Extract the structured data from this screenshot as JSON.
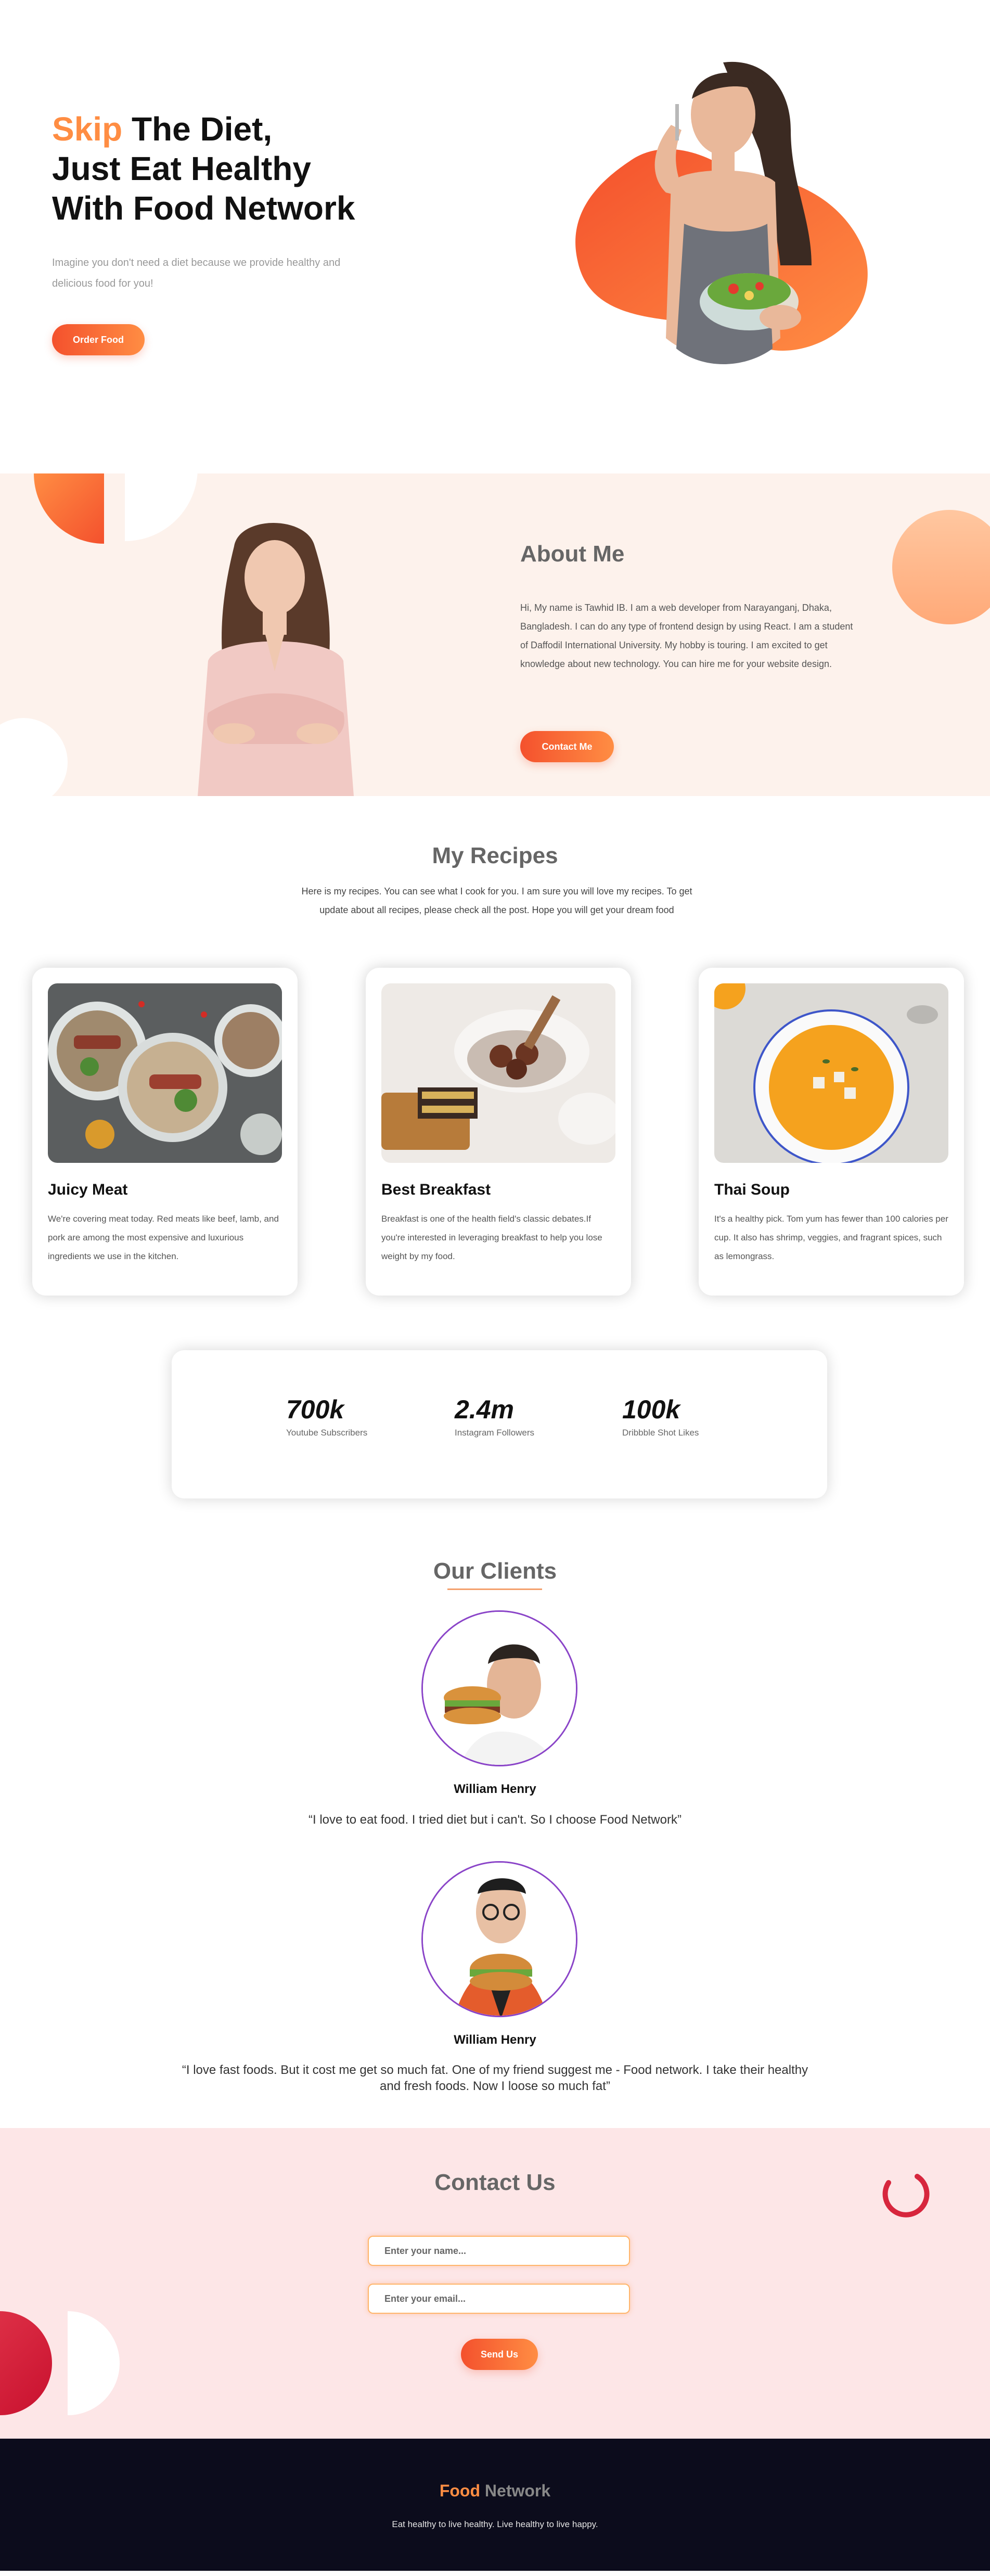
{
  "hero": {
    "title_accent": "Skip",
    "title_line1": " The Diet,",
    "title_line2": "Just Eat Healthy",
    "title_line3": "With Food Network",
    "subtitle": "Imagine you don't need a diet because we provide healthy and delicious food for you!",
    "button_label": "Order Food"
  },
  "about": {
    "title": "About Me",
    "text": "Hi, My name is Tawhid IB. I am a web developer from Narayanganj, Dhaka, Bangladesh. I can do any type of frontend design by using React. I am a student of Daffodil International University. My hobby is touring. I am excited to get knowledge about new technology. You can hire me for your website design.",
    "button_label": "Contact Me"
  },
  "recipes": {
    "title": "My Recipes",
    "intro": "Here is my recipes. You can see what I cook for you. I am sure you will love my recipes. To get update about all recipes, please check all the post. Hope you will get your dream food",
    "cards": [
      {
        "title": "Juicy Meat",
        "text": "We're covering meat today. Red meats like beef, lamb, and pork are among the most expensive and luxurious ingredients we use in the kitchen."
      },
      {
        "title": "Best Breakfast",
        "text": "Breakfast is one of the health field's classic debates.If you're interested in leveraging breakfast to help you lose weight by my food."
      },
      {
        "title": "Thai Soup",
        "text": "It's a healthy pick. Tom yum has fewer than 100 calories per cup. It also has shrimp, veggies, and fragrant spices, such as lemongrass."
      }
    ]
  },
  "stats": [
    {
      "value": "700k",
      "label": "Youtube Subscribers"
    },
    {
      "value": "2.4m",
      "label": "Instagram Followers"
    },
    {
      "value": "100k",
      "label": "Dribbble Shot Likes"
    }
  ],
  "clients": {
    "title": "Our Clients",
    "items": [
      {
        "name": "William Henry",
        "quote": "“I love to eat food. I tried diet but i can't. So I choose Food Network”"
      },
      {
        "name": "William Henry",
        "quote": "“I love fast foods. But it cost me get so much fat. One of my friend suggest me - Food network. I take their healthy and fresh foods. Now I loose so much fat”"
      }
    ]
  },
  "contact": {
    "title": "Contact Us",
    "name_placeholder": "Enter your name...",
    "email_placeholder": "Enter your email...",
    "button_label": "Send Us"
  },
  "footer": {
    "brand_accent": "Food",
    "brand_rest": " Network",
    "tagline": "Eat healthy to live healthy. Live healthy to live happy."
  },
  "colors": {
    "accent": "#ff8d43",
    "accent_dark": "#f4512d",
    "about_bg": "#fdf2ec",
    "contact_bg": "#fde6e7",
    "footer_bg": "#0c0c1c",
    "avatar_border": "#8a44c8"
  }
}
